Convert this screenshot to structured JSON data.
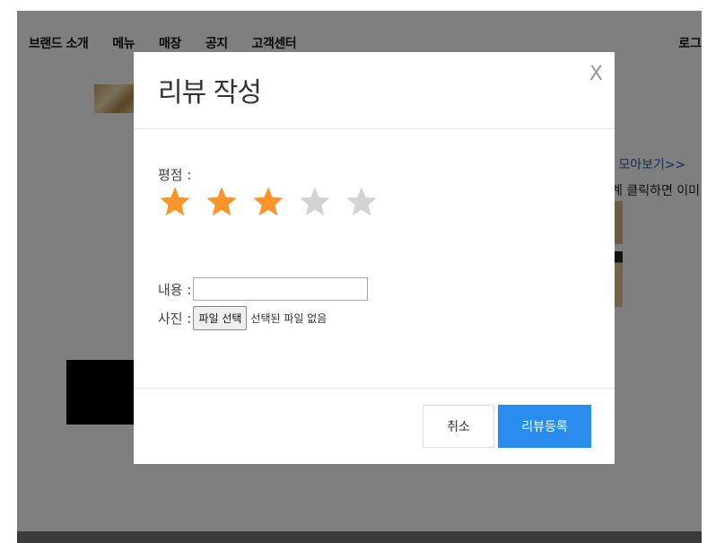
{
  "nav": {
    "items": [
      "브랜드 소개",
      "메뉴",
      "매장",
      "공지",
      "고객센터"
    ],
    "right_label": "로그"
  },
  "background": {
    "more_link": "l 모아보기>>",
    "click_hint": "계 클릭하면 이미"
  },
  "modal": {
    "title": "리뷰 작성",
    "close_symbol": "X",
    "rating_label": "평점 :",
    "rating": {
      "value": 3,
      "max": 5,
      "filled_color": "#fc942b",
      "empty_color": "#d3d3d3"
    },
    "content_label": "내용 :",
    "content_value": "",
    "photo_label": "사진 :",
    "file_button_label": "파일 선택",
    "file_status": "선택된 파일 없음",
    "cancel_label": "취소",
    "submit_label": "리뷰등록"
  },
  "colors": {
    "accent": "#2b8cef",
    "overlay": "rgba(0,0,0,0.5)"
  }
}
